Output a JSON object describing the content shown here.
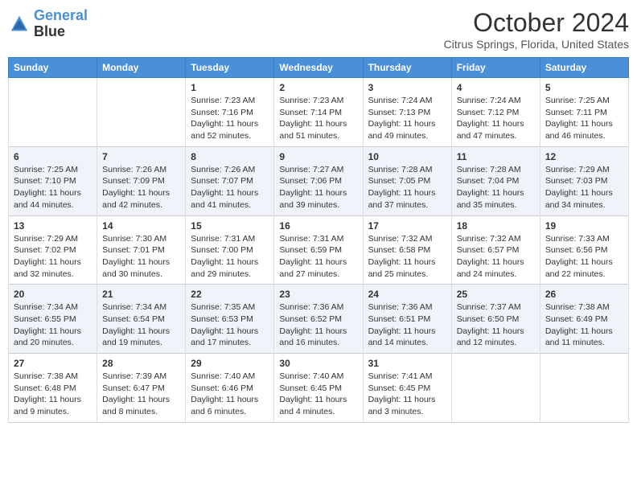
{
  "header": {
    "logo_line1": "General",
    "logo_line2": "Blue",
    "month": "October 2024",
    "location": "Citrus Springs, Florida, United States"
  },
  "days_of_week": [
    "Sunday",
    "Monday",
    "Tuesday",
    "Wednesday",
    "Thursday",
    "Friday",
    "Saturday"
  ],
  "weeks": [
    [
      {
        "day": "",
        "info": ""
      },
      {
        "day": "",
        "info": ""
      },
      {
        "day": "1",
        "info": "Sunrise: 7:23 AM\nSunset: 7:16 PM\nDaylight: 11 hours and 52 minutes."
      },
      {
        "day": "2",
        "info": "Sunrise: 7:23 AM\nSunset: 7:14 PM\nDaylight: 11 hours and 51 minutes."
      },
      {
        "day": "3",
        "info": "Sunrise: 7:24 AM\nSunset: 7:13 PM\nDaylight: 11 hours and 49 minutes."
      },
      {
        "day": "4",
        "info": "Sunrise: 7:24 AM\nSunset: 7:12 PM\nDaylight: 11 hours and 47 minutes."
      },
      {
        "day": "5",
        "info": "Sunrise: 7:25 AM\nSunset: 7:11 PM\nDaylight: 11 hours and 46 minutes."
      }
    ],
    [
      {
        "day": "6",
        "info": "Sunrise: 7:25 AM\nSunset: 7:10 PM\nDaylight: 11 hours and 44 minutes."
      },
      {
        "day": "7",
        "info": "Sunrise: 7:26 AM\nSunset: 7:09 PM\nDaylight: 11 hours and 42 minutes."
      },
      {
        "day": "8",
        "info": "Sunrise: 7:26 AM\nSunset: 7:07 PM\nDaylight: 11 hours and 41 minutes."
      },
      {
        "day": "9",
        "info": "Sunrise: 7:27 AM\nSunset: 7:06 PM\nDaylight: 11 hours and 39 minutes."
      },
      {
        "day": "10",
        "info": "Sunrise: 7:28 AM\nSunset: 7:05 PM\nDaylight: 11 hours and 37 minutes."
      },
      {
        "day": "11",
        "info": "Sunrise: 7:28 AM\nSunset: 7:04 PM\nDaylight: 11 hours and 35 minutes."
      },
      {
        "day": "12",
        "info": "Sunrise: 7:29 AM\nSunset: 7:03 PM\nDaylight: 11 hours and 34 minutes."
      }
    ],
    [
      {
        "day": "13",
        "info": "Sunrise: 7:29 AM\nSunset: 7:02 PM\nDaylight: 11 hours and 32 minutes."
      },
      {
        "day": "14",
        "info": "Sunrise: 7:30 AM\nSunset: 7:01 PM\nDaylight: 11 hours and 30 minutes."
      },
      {
        "day": "15",
        "info": "Sunrise: 7:31 AM\nSunset: 7:00 PM\nDaylight: 11 hours and 29 minutes."
      },
      {
        "day": "16",
        "info": "Sunrise: 7:31 AM\nSunset: 6:59 PM\nDaylight: 11 hours and 27 minutes."
      },
      {
        "day": "17",
        "info": "Sunrise: 7:32 AM\nSunset: 6:58 PM\nDaylight: 11 hours and 25 minutes."
      },
      {
        "day": "18",
        "info": "Sunrise: 7:32 AM\nSunset: 6:57 PM\nDaylight: 11 hours and 24 minutes."
      },
      {
        "day": "19",
        "info": "Sunrise: 7:33 AM\nSunset: 6:56 PM\nDaylight: 11 hours and 22 minutes."
      }
    ],
    [
      {
        "day": "20",
        "info": "Sunrise: 7:34 AM\nSunset: 6:55 PM\nDaylight: 11 hours and 20 minutes."
      },
      {
        "day": "21",
        "info": "Sunrise: 7:34 AM\nSunset: 6:54 PM\nDaylight: 11 hours and 19 minutes."
      },
      {
        "day": "22",
        "info": "Sunrise: 7:35 AM\nSunset: 6:53 PM\nDaylight: 11 hours and 17 minutes."
      },
      {
        "day": "23",
        "info": "Sunrise: 7:36 AM\nSunset: 6:52 PM\nDaylight: 11 hours and 16 minutes."
      },
      {
        "day": "24",
        "info": "Sunrise: 7:36 AM\nSunset: 6:51 PM\nDaylight: 11 hours and 14 minutes."
      },
      {
        "day": "25",
        "info": "Sunrise: 7:37 AM\nSunset: 6:50 PM\nDaylight: 11 hours and 12 minutes."
      },
      {
        "day": "26",
        "info": "Sunrise: 7:38 AM\nSunset: 6:49 PM\nDaylight: 11 hours and 11 minutes."
      }
    ],
    [
      {
        "day": "27",
        "info": "Sunrise: 7:38 AM\nSunset: 6:48 PM\nDaylight: 11 hours and 9 minutes."
      },
      {
        "day": "28",
        "info": "Sunrise: 7:39 AM\nSunset: 6:47 PM\nDaylight: 11 hours and 8 minutes."
      },
      {
        "day": "29",
        "info": "Sunrise: 7:40 AM\nSunset: 6:46 PM\nDaylight: 11 hours and 6 minutes."
      },
      {
        "day": "30",
        "info": "Sunrise: 7:40 AM\nSunset: 6:45 PM\nDaylight: 11 hours and 4 minutes."
      },
      {
        "day": "31",
        "info": "Sunrise: 7:41 AM\nSunset: 6:45 PM\nDaylight: 11 hours and 3 minutes."
      },
      {
        "day": "",
        "info": ""
      },
      {
        "day": "",
        "info": ""
      }
    ]
  ]
}
